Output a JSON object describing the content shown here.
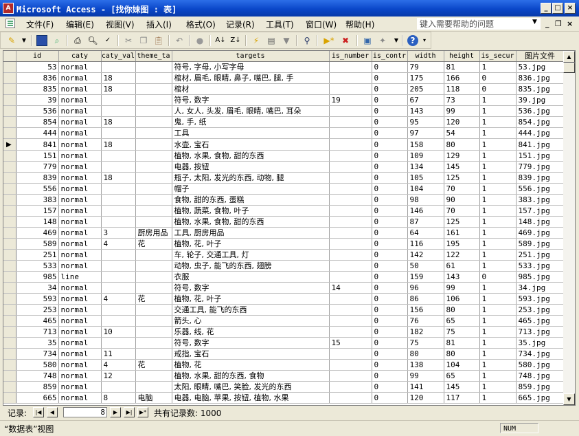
{
  "window": {
    "title": "Microsoft Access - [找你妹图 : 表]"
  },
  "menu": {
    "items": [
      "文件(F)",
      "编辑(E)",
      "视图(V)",
      "插入(I)",
      "格式(O)",
      "记录(R)",
      "工具(T)",
      "窗口(W)",
      "帮助(H)"
    ],
    "help_placeholder": "键入需要帮助的问题"
  },
  "toolbar": {
    "icons": [
      "design-view-icon",
      "save-icon",
      "search-icon",
      "print-icon",
      "print-preview-icon",
      "spelling-icon",
      "cut-icon",
      "copy-icon",
      "paste-icon",
      "undo-icon",
      "hyperlink-icon",
      "sort-ascending-icon",
      "sort-descending-icon",
      "filter-by-selection-icon",
      "filter-by-form-icon",
      "apply-filter-icon",
      "find-icon",
      "new-record-icon",
      "delete-record-icon",
      "database-window-icon",
      "new-object-icon",
      "help-icon"
    ]
  },
  "table": {
    "columns": [
      "id",
      "caty",
      "caty_val",
      "theme_ta",
      "targets",
      "is_number",
      "is_contr",
      "width",
      "height",
      "is_secur",
      "图片文件"
    ],
    "rows": [
      [
        "53",
        "normal",
        "",
        "",
        "符号, 字母, 小写字母",
        "",
        "0",
        "79",
        "81",
        "1",
        "53.jpg"
      ],
      [
        "836",
        "normal",
        "18",
        "",
        "棺材, 眉毛, 眼睛, 鼻子, 嘴巴, 腿, 手",
        "",
        "0",
        "175",
        "166",
        "0",
        "836.jpg"
      ],
      [
        "835",
        "normal",
        "18",
        "",
        "棺材",
        "",
        "0",
        "205",
        "118",
        "0",
        "835.jpg"
      ],
      [
        "39",
        "normal",
        "",
        "",
        "符号, 数字",
        "19",
        "0",
        "67",
        "73",
        "1",
        "39.jpg"
      ],
      [
        "536",
        "normal",
        "",
        "",
        "人, 女人, 头发, 眉毛, 眼睛, 嘴巴, 耳朵",
        "",
        "0",
        "143",
        "99",
        "1",
        "536.jpg"
      ],
      [
        "854",
        "normal",
        "18",
        "",
        "鬼, 手, 纸",
        "",
        "0",
        "95",
        "120",
        "1",
        "854.jpg"
      ],
      [
        "444",
        "normal",
        "",
        "",
        "工具",
        "",
        "0",
        "97",
        "54",
        "1",
        "444.jpg"
      ],
      [
        "841",
        "normal",
        "18",
        "",
        "水壶, 宝石",
        "",
        "0",
        "158",
        "80",
        "1",
        "841.jpg"
      ],
      [
        "151",
        "normal",
        "",
        "",
        "植物, 水果, 食物, 甜的东西",
        "",
        "0",
        "109",
        "129",
        "1",
        "151.jpg"
      ],
      [
        "779",
        "normal",
        "",
        "",
        "电器, 按钮",
        "",
        "0",
        "134",
        "145",
        "1",
        "779.jpg"
      ],
      [
        "839",
        "normal",
        "18",
        "",
        "瓶子, 太阳, 发光的东西, 动物, 腿",
        "",
        "0",
        "105",
        "125",
        "1",
        "839.jpg"
      ],
      [
        "556",
        "normal",
        "",
        "",
        "帽子",
        "",
        "0",
        "104",
        "70",
        "1",
        "556.jpg"
      ],
      [
        "383",
        "normal",
        "",
        "",
        "食物, 甜的东西, 蛋糕",
        "",
        "0",
        "98",
        "90",
        "1",
        "383.jpg"
      ],
      [
        "157",
        "normal",
        "",
        "",
        "植物, 蔬菜, 食物, 叶子",
        "",
        "0",
        "146",
        "70",
        "1",
        "157.jpg"
      ],
      [
        "148",
        "normal",
        "",
        "",
        "植物, 水果, 食物, 甜的东西",
        "",
        "0",
        "87",
        "125",
        "1",
        "148.jpg"
      ],
      [
        "469",
        "normal",
        "3",
        "厨房用品",
        "工具, 厨房用品",
        "",
        "0",
        "64",
        "161",
        "1",
        "469.jpg"
      ],
      [
        "589",
        "normal",
        "4",
        "花",
        "植物, 花, 叶子",
        "",
        "0",
        "116",
        "195",
        "1",
        "589.jpg"
      ],
      [
        "251",
        "normal",
        "",
        "",
        "车, 轮子, 交通工具, 灯",
        "",
        "0",
        "142",
        "122",
        "1",
        "251.jpg"
      ],
      [
        "533",
        "normal",
        "",
        "",
        "动物, 虫子, 能飞的东西, 翅膀",
        "",
        "0",
        "50",
        "61",
        "1",
        "533.jpg"
      ],
      [
        "985",
        "line",
        "",
        "",
        "衣服",
        "",
        "0",
        "159",
        "143",
        "0",
        "985.jpg"
      ],
      [
        "34",
        "normal",
        "",
        "",
        "符号, 数字",
        "14",
        "0",
        "96",
        "99",
        "1",
        "34.jpg"
      ],
      [
        "593",
        "normal",
        "4",
        "花",
        "植物, 花, 叶子",
        "",
        "0",
        "86",
        "106",
        "1",
        "593.jpg"
      ],
      [
        "253",
        "normal",
        "",
        "",
        "交通工具, 能飞的东西",
        "",
        "0",
        "156",
        "80",
        "1",
        "253.jpg"
      ],
      [
        "465",
        "normal",
        "",
        "",
        "箭头, 心",
        "",
        "0",
        "76",
        "65",
        "1",
        "465.jpg"
      ],
      [
        "713",
        "normal",
        "10",
        "",
        "乐器, 线, 花",
        "",
        "0",
        "182",
        "75",
        "1",
        "713.jpg"
      ],
      [
        "35",
        "normal",
        "",
        "",
        "符号, 数字",
        "15",
        "0",
        "75",
        "81",
        "1",
        "35.jpg"
      ],
      [
        "734",
        "normal",
        "11",
        "",
        "戒指, 宝石",
        "",
        "0",
        "80",
        "80",
        "1",
        "734.jpg"
      ],
      [
        "580",
        "normal",
        "4",
        "花",
        "植物, 花",
        "",
        "0",
        "138",
        "104",
        "1",
        "580.jpg"
      ],
      [
        "748",
        "normal",
        "12",
        "",
        "植物, 水果, 甜的东西, 食物",
        "",
        "0",
        "99",
        "65",
        "1",
        "748.jpg"
      ],
      [
        "859",
        "normal",
        "",
        "",
        "太阳, 眼睛, 嘴巴, 笑脸, 发光的东西",
        "",
        "0",
        "141",
        "145",
        "1",
        "859.jpg"
      ],
      [
        "665",
        "normal",
        "8",
        "电脑",
        "电器, 电脑, 苹果, 按钮, 植物, 水果",
        "",
        "0",
        "120",
        "117",
        "1",
        "665.jpg"
      ]
    ],
    "current_row": 7
  },
  "navigator": {
    "label": "记录:",
    "current": "8",
    "total_label": "共有记录数: 1000"
  },
  "status": {
    "text": "“数据表”视图",
    "num": "NUM"
  }
}
